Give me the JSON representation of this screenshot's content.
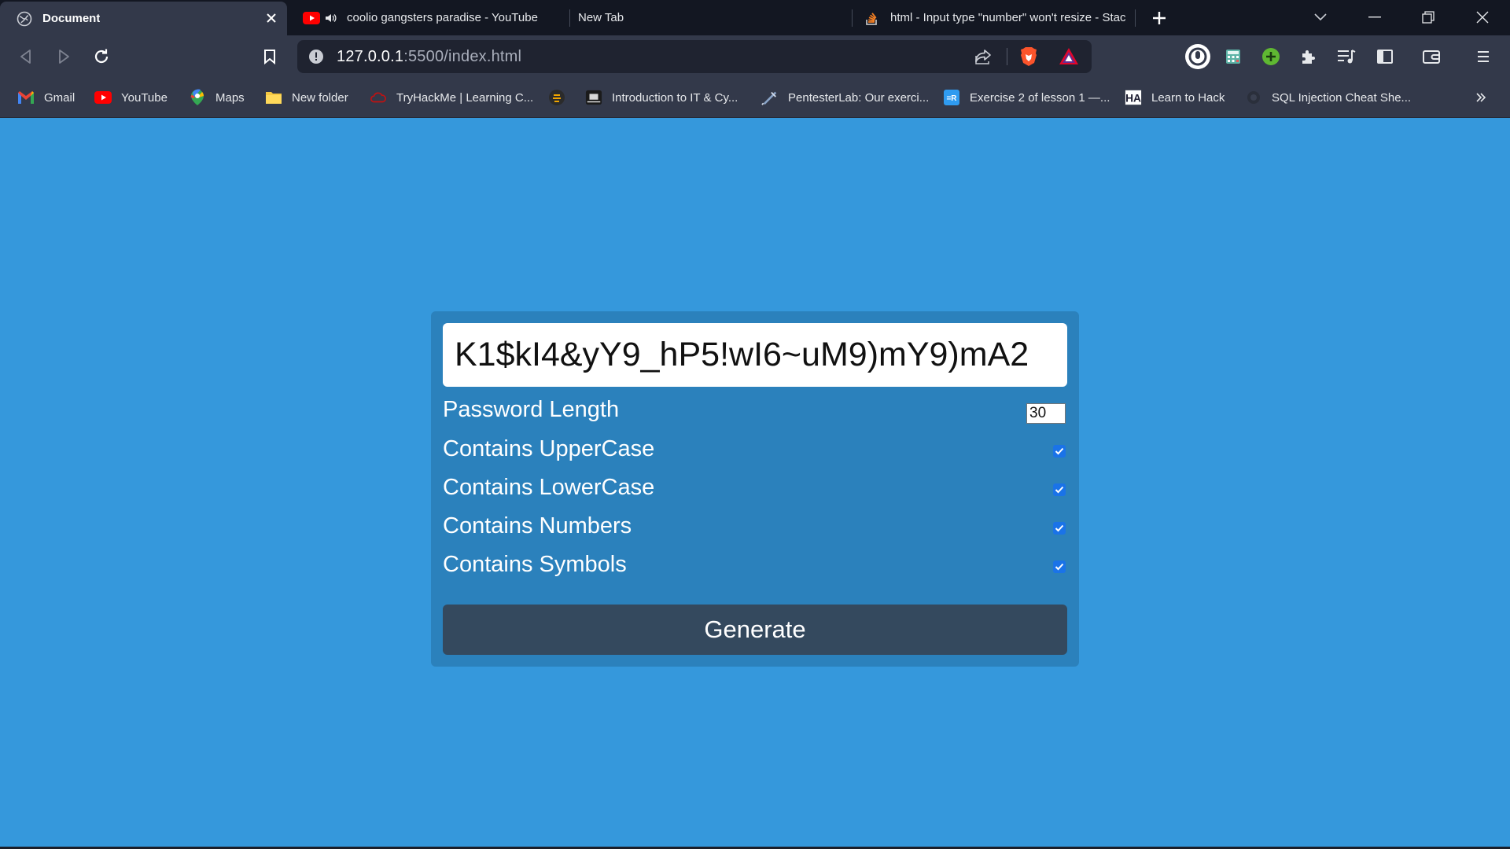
{
  "browser": {
    "tabs": [
      {
        "title": "Document",
        "active": true,
        "icon": "globe-icon"
      },
      {
        "title": "coolio gangsters paradise - YouTube",
        "active": false,
        "icon": "youtube-icon",
        "audio": true
      },
      {
        "title": "New Tab",
        "active": false,
        "icon": ""
      },
      {
        "title": "html - Input type \"number\" won't resize - Stac",
        "active": false,
        "icon": "stackoverflow-icon"
      }
    ],
    "url": {
      "host": "127.0.0.1",
      "path": ":5500/index.html"
    },
    "bookmarks": [
      {
        "label": "Gmail",
        "icon": "gmail-icon"
      },
      {
        "label": "YouTube",
        "icon": "youtube-icon"
      },
      {
        "label": "Maps",
        "icon": "maps-icon"
      },
      {
        "label": "New folder",
        "icon": "folder-icon"
      },
      {
        "label": "TryHackMe | Learning C...",
        "icon": "tryhackme-icon"
      },
      {
        "label": "",
        "icon": "linux-icon"
      },
      {
        "label": "Introduction to IT & Cy...",
        "icon": "cybrary-icon"
      },
      {
        "label": "PentesterLab: Our exerci...",
        "icon": "pentesterlab-icon"
      },
      {
        "label": "Exercise 2 of lesson 1 —...",
        "icon": "exercise-icon"
      },
      {
        "label": "Learn to Hack",
        "icon": "hackerone-icon"
      },
      {
        "label": "SQL Injection Cheat She...",
        "icon": "sql-icon"
      }
    ],
    "colors": {
      "tabstrip": "#131722",
      "toolbar": "#33394a",
      "page_bg": "#3598dc",
      "card_bg": "#2b81bc",
      "button_bg": "#34495e"
    }
  },
  "app": {
    "password": "K1$kI4&yY9_hP5!wI6~uM9)mY9)mA2",
    "length_label": "Password Length",
    "length_value": "30",
    "options": [
      {
        "label": "Contains UpperCase",
        "checked": true
      },
      {
        "label": "Contains LowerCase",
        "checked": true
      },
      {
        "label": "Contains Numbers",
        "checked": true
      },
      {
        "label": "Contains Symbols",
        "checked": true
      }
    ],
    "generate_label": "Generate"
  }
}
